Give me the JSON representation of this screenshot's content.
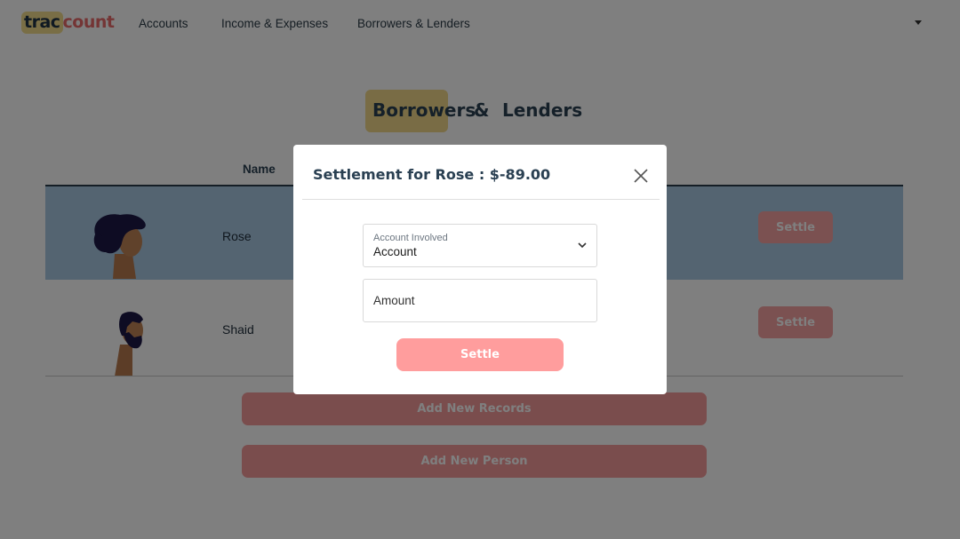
{
  "app": {
    "logo_part1": "trac",
    "logo_part2": "count"
  },
  "nav": {
    "items": [
      {
        "label": "Accounts"
      },
      {
        "label": "Income & Expenses"
      },
      {
        "label": "Borrowers & Lenders"
      }
    ],
    "user_menu_icon": "caret-down-icon"
  },
  "page": {
    "heading_word1": "Borrowers",
    "heading_amp": "&",
    "heading_word2": "Lenders"
  },
  "table": {
    "column_name": "Name",
    "rows": [
      {
        "name": "Rose",
        "avatar": "woman-avatar-icon",
        "settle_label": "Settle",
        "selected": true
      },
      {
        "name": "Shaid",
        "avatar": "bearded-man-avatar-icon",
        "settle_label": "Settle",
        "selected": false
      }
    ]
  },
  "buttons": {
    "add_records": "Add New Records",
    "add_person": "Add New Person"
  },
  "modal": {
    "title": "Settlement for Rose : $-89.00",
    "close_icon": "close-icon",
    "account_label": "Account Involved",
    "account_value": "Account",
    "amount_placeholder": "Amount",
    "settle_label": "Settle"
  },
  "colors": {
    "accent_yellow": "#f3d98a",
    "accent_coral": "#f7a3a3",
    "selected_row": "#a8c8e3",
    "brand_dark": "#2a4052"
  }
}
